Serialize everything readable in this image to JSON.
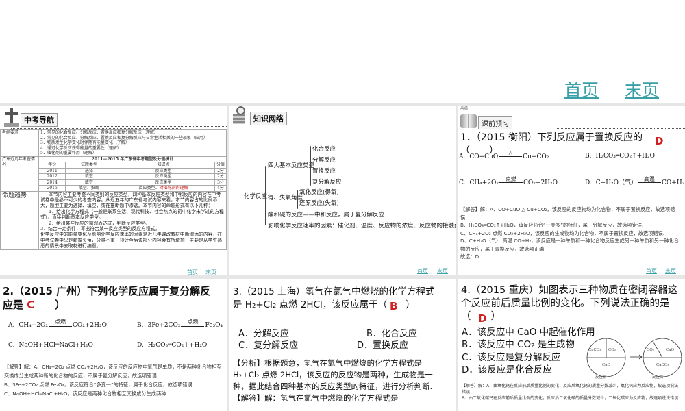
{
  "top_nav": {
    "first": "首页",
    "last": "末页"
  },
  "panel1": {
    "header": "中考导航",
    "req_label": "考纲要求",
    "req_items": [
      "1．常见的化合反应、分解反应、置换反应和复分解反应（理解）",
      "2．常见的化合反应、分解反应、置换反应和复分解反应与日常生活相关的一些现象（应用）",
      "3．物质发生化学变化时伴随有能量变化（了解）",
      "4．通过化学反应获得能量的重要性（理解）",
      "5．催化剂的重要作用（理解）"
    ],
    "exam_label": "广东近几年考查情况",
    "table_title": "2011—2015 年广东省中考题型及分值统计",
    "headers": [
      "年份",
      "试题类型",
      "知识点",
      "分值"
    ],
    "rows": [
      [
        "2011",
        "选择",
        "反应类型",
        "2分"
      ],
      [
        "2012",
        "填空",
        "反应类型",
        "2分"
      ],
      [
        "2014",
        "填空",
        "反应类型",
        "3分"
      ],
      [
        "2015",
        "填空、推断",
        "反应类型、",
        "4分"
      ]
    ],
    "row4_red": "对催化剂的理解",
    "trend_label": "命题趋势",
    "trend_lines": [
      "本节内容主要考查不同类别的反应类型，四种基本反应类型和中和反应的内容在中考试卷中是必不可少的考查内容。从近五年的广东省考试内容来看，本节内容占的比例不大，题型主要为选择、填空，或在推断题中渗透。本节内容的命题形式有以下几种：",
      "1．给出化学方程式（一般是联系生活、现代科技、社会热点的初中化学未学过的方程式），直接判断基本反应类型。",
      "2．给出某些反应的微观表达式，判断反应类型。",
      "3．结合一定条件，写出符合某一反应类型的反应方程式。",
      "化学反应中的能量变化及影响化学反应速率的因素是近几年课改教材中新增添的内容，在中考试卷中只是崭露头角，分量不重，预计今后该部分内容会有所增加，主要是从学生熟悉的情景中去取材进行编题。"
    ],
    "nav": {
      "first": "首页",
      "last": "末页"
    }
  },
  "panel2": {
    "header": "知识网络",
    "root": "化学反应",
    "b1": "四大基本反应类型",
    "b1_items": [
      "化合反应",
      "分解反应",
      "置换反应",
      "复分解反应"
    ],
    "b2": "得、失氧角度",
    "b2_items": [
      "氧化反应(得氧)",
      "还原反应(失氧)"
    ],
    "b3": "酸和碱的反应——中和反应，属于复分解反应",
    "b4": "影响化学反应速率的因素：催化剂、温度、反应物的浓度、反应物的接触面积等等",
    "nav": {
      "first": "首页",
      "last": "末页"
    }
  },
  "panel3": {
    "corner": "高温",
    "header": "课前预习",
    "question": "1．（2015 衡阳）下列反应属于置换反应的（　　）",
    "answer": "D",
    "options": [
      {
        "label": "A.",
        "lhs": "CO+CuO",
        "cond": "△",
        "rhs": "Cu+CO₂"
      },
      {
        "label": "B.",
        "text": "H₂CO₃═CO₂↑+H₂O"
      },
      {
        "label": "C.",
        "lhs": "CH₄+2O₂",
        "cond": "点燃",
        "rhs": "CO₂+2H₂O"
      },
      {
        "label": "D.",
        "lhs": "C+H₂O（气）",
        "cond": "高温",
        "rhs": "CO+H₂"
      }
    ],
    "solution": [
      "【解答】解：A、CO+CuO △ Cu+CO₂，该反应的反应物均为化合物，不属于置换反应，故选项错误.",
      "B、H₂CO₃═CO₂↑+H₂O，该反应符合“一变多”的特征，属于分解反应，故选项错误.",
      "C、CH₄+2O₂ 点燃 CO₂+2H₂O，该反应的生成物均为化合物，不属于置换反应，故选项错误.",
      "D、C+H₂O（气） 高温 CO+H₂，该反应是一种单质和一种化合物反应生成另一种单质和另一种化合物的反应，属于置换反应，故选项正确.",
      "故选：D"
    ],
    "nav": {
      "first": "首页",
      "last": "末页"
    }
  },
  "panel4": {
    "question": "2.（2015 广州）下列化学反应属于复分解反应是",
    "answer": "C",
    "close": "）",
    "options": [
      {
        "label": "A.",
        "lhs": "CH₄+2O₂",
        "cond": "点燃",
        "rhs": "CO₂+2H₂O"
      },
      {
        "label": "B.",
        "lhs": "3Fe+2CO₂",
        "cond": "点燃",
        "rhs": "Fe₃O₄"
      },
      {
        "label": "C.",
        "text": "NaOH+HCl═NaCl+H₂O"
      },
      {
        "label": "D.",
        "text": "H₂CO₃═CO₂↑+H₂O"
      }
    ],
    "solution": [
      "【解答】解：A、CH₄+2O₂ 点燃 CO₂+2H₂O，该反应的反应物中氧气是单质，不是两种化合物相互交换成分生成两种新的化合物的反应，不属于复分解反应，故选项错误.",
      "B、3Fe+2CO₂ 点燃 Fe₃O₄，该反应符合“多变一”的特征，属于化合反应，故选项错误.",
      "C、NaOH+HCl═NaCl+H₂O，该反应是两种化合物相互交换成分生成两种"
    ]
  },
  "panel5": {
    "question": "3.（2015 上海）氢气在氯气中燃烧的化学方程式是 H₂+Cl₂ 点燃 2HCl，该反应属于（　　）",
    "answer": "B",
    "options": [
      "A．分解反应",
      "B．化合反应",
      "C．复分解反应",
      "D．置换反应"
    ],
    "analysis": "【分析】根据题意，氢气在氯气中燃烧的化学方程式是 H₂+Cl₂ 点燃 2HCl，该反应的反应物是两种，生成物是一种，据此结合四种基本的反应类型的特征，进行分析判断.",
    "solution": "【解答】解：氢气在氯气中燃烧的化学方程式是"
  },
  "panel6": {
    "question": "4.（2015 重庆）如图表示三种物质在密闭容器这个反应前后质量比例的变化。下列说法正确的是（　　）",
    "answer": "D",
    "options": [
      "A．该反应中 CaO 中起催化作用",
      "B．该反应中 CO₂ 是生成物",
      "C．该反应是复分解反应",
      "D．该反应是化合反应"
    ],
    "pie_before": {
      "caption": "反应前",
      "labels": [
        "CaCO₃",
        "CO₂",
        "CaO"
      ]
    },
    "pie_after": {
      "caption": "反应后",
      "labels": [
        "CO₂",
        "CaO",
        "CaCO₃"
      ]
    },
    "solution": [
      "【解答】解：A、由氧化钙在反应前后质量比例的变化，反应后氧化钙的质量分数减少，氧化钙应为反应物，故选项说法错误.",
      "B、由二氧化碳钙在反应前后质量比例的变化，反应后二氧化碳的质量分数减少，二氧化碳应为反应物，故选项说法错误."
    ]
  }
}
